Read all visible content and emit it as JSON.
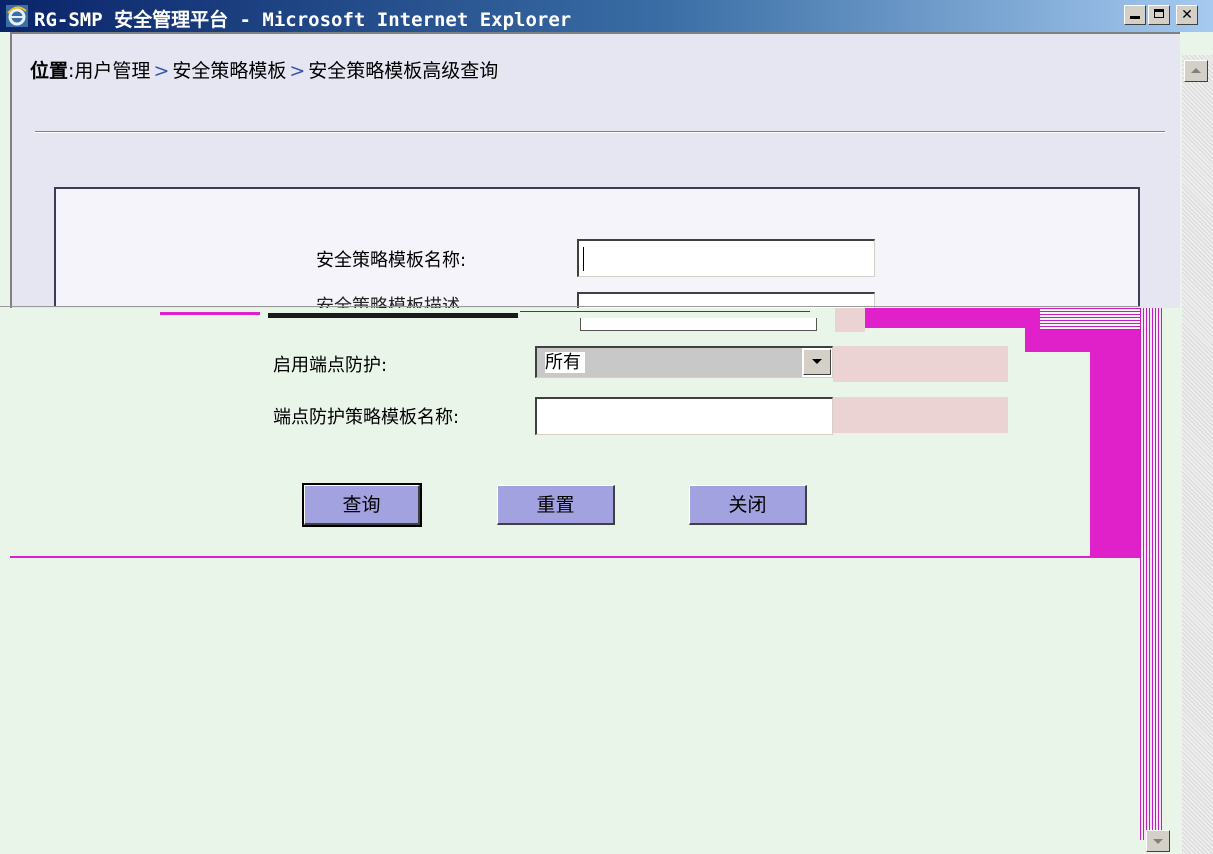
{
  "window": {
    "title": "RG-SMP 安全管理平台 - Microsoft Internet Explorer",
    "icon": "ie-icon"
  },
  "breadcrumb": {
    "lead": "位置",
    "colon": ":",
    "items": [
      "用户管理",
      "安全策略模板",
      "安全策略模板高级查询"
    ],
    "separator": ">"
  },
  "form": {
    "template_name_label": "安全策略模板名称:",
    "template_name_value": "",
    "template_desc_label": "安全策略模板描述",
    "template_desc_value": "",
    "endpoint_protection_label": "启用端点防护:",
    "endpoint_protection_selected": "所有",
    "endpoint_template_label": "端点防护策略模板名称:",
    "endpoint_template_value": ""
  },
  "buttons": {
    "query": "查询",
    "reset": "重置",
    "close": "关闭"
  },
  "colors": {
    "page_upper": "#e6e6f2",
    "page_lower": "#e9f5e9",
    "button": "#a2a2e0",
    "glitch_magenta": "#e020c8"
  }
}
